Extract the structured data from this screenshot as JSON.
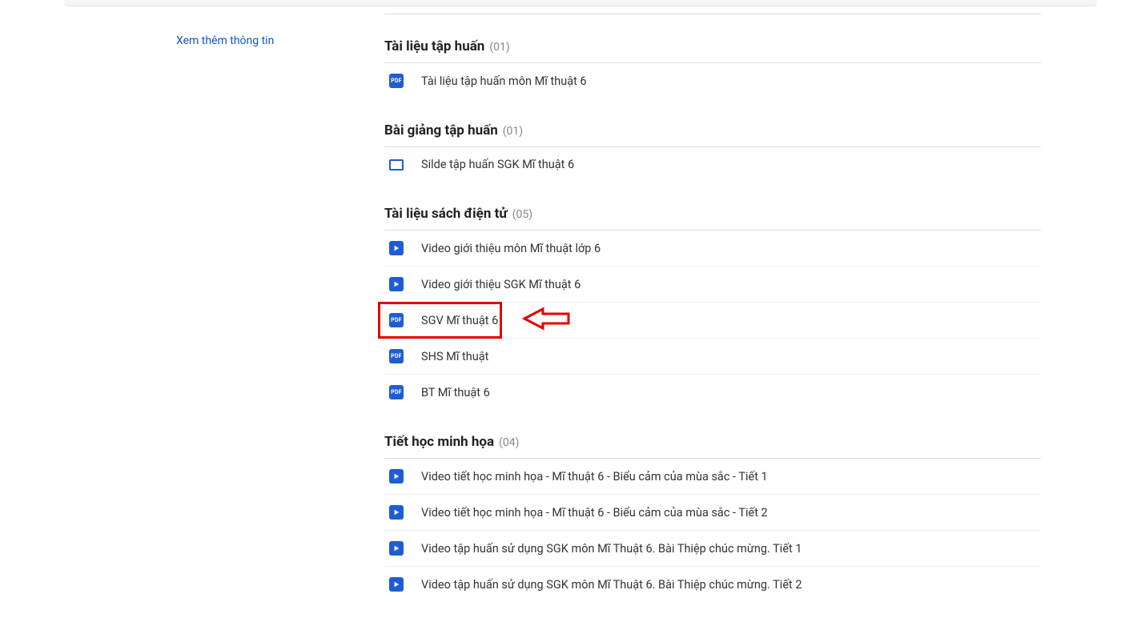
{
  "sidebar": {
    "link": "Xem thêm thông tin"
  },
  "partial_section": {
    "count": "()"
  },
  "sections": [
    {
      "id": "tap-huan",
      "title": "Tài liệu tập huấn",
      "count": "(01)",
      "items": [
        {
          "type": "pdf",
          "label": "Tài liệu tập huấn môn Mĩ thuật 6",
          "highlighted": false
        }
      ]
    },
    {
      "id": "bai-giang",
      "title": "Bài giảng tập huấn",
      "count": "(01)",
      "items": [
        {
          "type": "presentation",
          "label": "Silde tập huấn SGK Mĩ thuật 6",
          "highlighted": false
        }
      ]
    },
    {
      "id": "sach-dien-tu",
      "title": "Tài liệu sách điện tử",
      "count": "(05)",
      "items": [
        {
          "type": "video",
          "label": "Video giới thiệu môn Mĩ thuật lớp 6",
          "highlighted": false
        },
        {
          "type": "video",
          "label": "Video giới thiệu SGK Mĩ thuật 6",
          "highlighted": false
        },
        {
          "type": "pdf",
          "label": "SGV Mĩ thuật 6",
          "highlighted": true
        },
        {
          "type": "pdf",
          "label": "SHS Mĩ thuật",
          "highlighted": false
        },
        {
          "type": "pdf",
          "label": "BT Mĩ thuật 6",
          "highlighted": false
        }
      ]
    },
    {
      "id": "tiet-hoc",
      "title": "Tiết học minh họa",
      "count": "(04)",
      "items": [
        {
          "type": "video",
          "label": "Video tiết học minh họa - Mĩ thuật 6 - Biểu cảm của mùa sắc - Tiết 1",
          "highlighted": false
        },
        {
          "type": "video",
          "label": "Video tiết học minh họa - Mĩ thuật 6 - Biểu cảm của mùa sắc - Tiết 2",
          "highlighted": false
        },
        {
          "type": "video",
          "label": "Video tập huấn sử dụng SGK môn Mĩ Thuật 6. Bài Thiệp chúc mừng. Tiết 1",
          "highlighted": false
        },
        {
          "type": "video",
          "label": "Video tập huấn sử dụng SGK môn Mĩ Thuật 6. Bài Thiệp chúc mừng. Tiết 2",
          "highlighted": false
        }
      ]
    }
  ],
  "icon_labels": {
    "pdf": "PDF"
  }
}
